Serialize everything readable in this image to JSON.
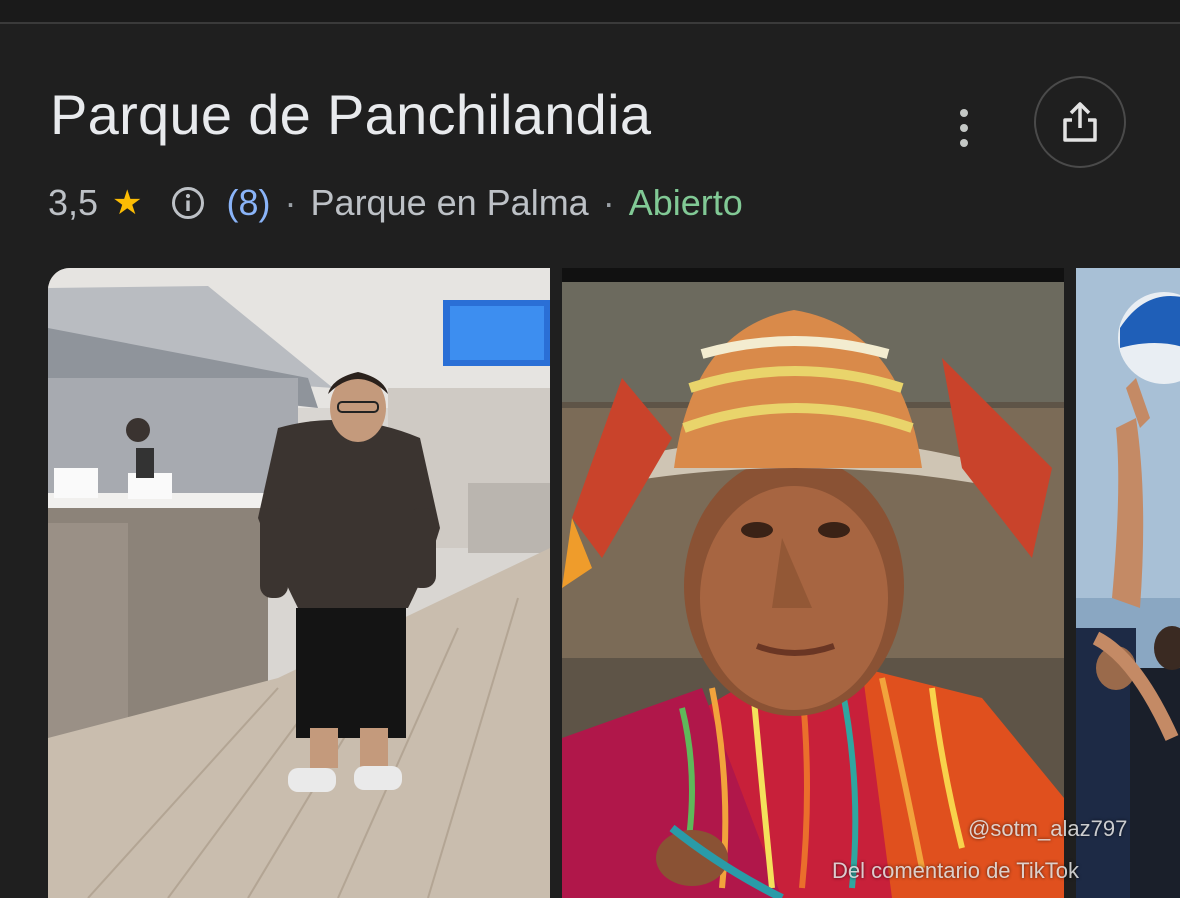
{
  "place": {
    "title": "Parque de Panchilandia",
    "rating": "3,5",
    "review_count": "(8)",
    "category": "Parque en Palma",
    "separator": "·",
    "status": "Abierto"
  },
  "icons": {
    "rating_star": "star-icon",
    "info": "info-icon",
    "more": "more-vert-icon",
    "share": "share-icon"
  },
  "photos": [
    {
      "subject": "person-in-restaurant"
    },
    {
      "subject": "person-in-andean-hat"
    },
    {
      "subject": "volleyball-players"
    }
  ],
  "watermark": {
    "handle": "@sotm_alaz797",
    "caption": "Del comentario de TikTok"
  },
  "colors": {
    "background": "#1f1f1f",
    "title": "#e8eaed",
    "meta_text": "#bdc1c6",
    "star": "#fbbc04",
    "review_link": "#8ab4f8",
    "open_status": "#81c995"
  }
}
